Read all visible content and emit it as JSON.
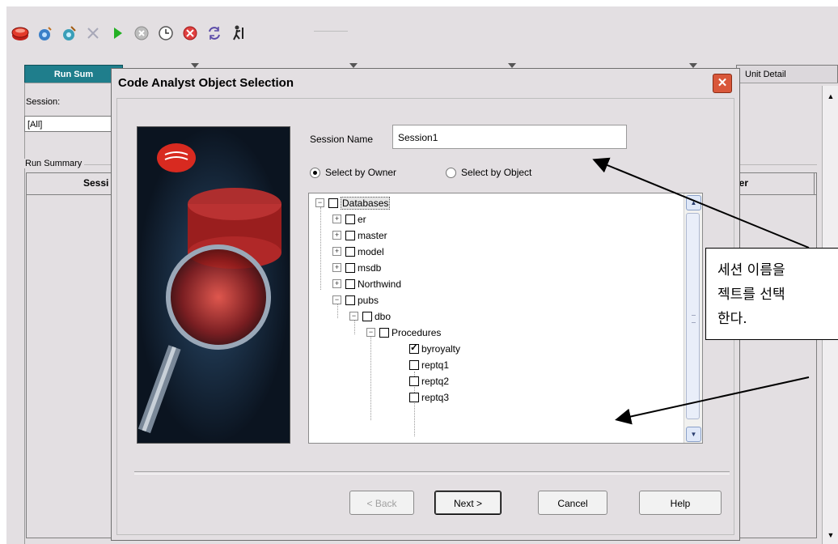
{
  "toolbar": {
    "icons": [
      "database-icon",
      "connect-icon",
      "disconnect-icon",
      "delete-icon",
      "run-icon",
      "stop-icon",
      "clock-icon",
      "cancel-icon",
      "refresh-icon",
      "filter-icon"
    ]
  },
  "main": {
    "tabs": {
      "run_summary": "Run Sum",
      "unit_detail": "Unit Detail"
    },
    "session_label": "Session:",
    "session_value": "[All]",
    "run_summary_label": "Run Summary",
    "columns": {
      "session": "Sessi",
      "scheduler": "uler"
    }
  },
  "dialog": {
    "title": "Code Analyst Object Selection",
    "close_label": "✕",
    "session_name_label": "Session Name",
    "session_name_value": "Session1",
    "radio_owner": "Select by Owner",
    "radio_object": "Select by Object",
    "radio_selected": "owner",
    "tree": [
      {
        "label": "Databases",
        "level": 0,
        "expander": "minus",
        "checked": false,
        "selected": true
      },
      {
        "label": "er",
        "level": 1,
        "expander": "plus",
        "checked": false
      },
      {
        "label": "master",
        "level": 1,
        "expander": "plus",
        "checked": false
      },
      {
        "label": "model",
        "level": 1,
        "expander": "plus",
        "checked": false
      },
      {
        "label": "msdb",
        "level": 1,
        "expander": "plus",
        "checked": false
      },
      {
        "label": "Northwind",
        "level": 1,
        "expander": "plus",
        "checked": false
      },
      {
        "label": "pubs",
        "level": 1,
        "expander": "minus",
        "checked": false
      },
      {
        "label": "dbo",
        "level": 2,
        "expander": "minus",
        "checked": false
      },
      {
        "label": "Procedures",
        "level": 3,
        "expander": "minus",
        "checked": false
      },
      {
        "label": "byroyalty",
        "level": 4,
        "expander": "none",
        "checked": true
      },
      {
        "label": "reptq1",
        "level": 4,
        "expander": "none",
        "checked": false
      },
      {
        "label": "reptq2",
        "level": 4,
        "expander": "none",
        "checked": false
      },
      {
        "label": "reptq3",
        "level": 4,
        "expander": "none",
        "checked": false
      }
    ],
    "buttons": {
      "back": "< Back",
      "next": "Next >",
      "cancel": "Cancel",
      "help": "Help"
    }
  },
  "annotation": {
    "lines": [
      "세션 이름을",
      "젝트를 선택",
      "한다."
    ]
  },
  "colors": {
    "tab_active": "#1f7e8c",
    "close": "#d9573a",
    "window_bg": "#e3dfe2"
  }
}
